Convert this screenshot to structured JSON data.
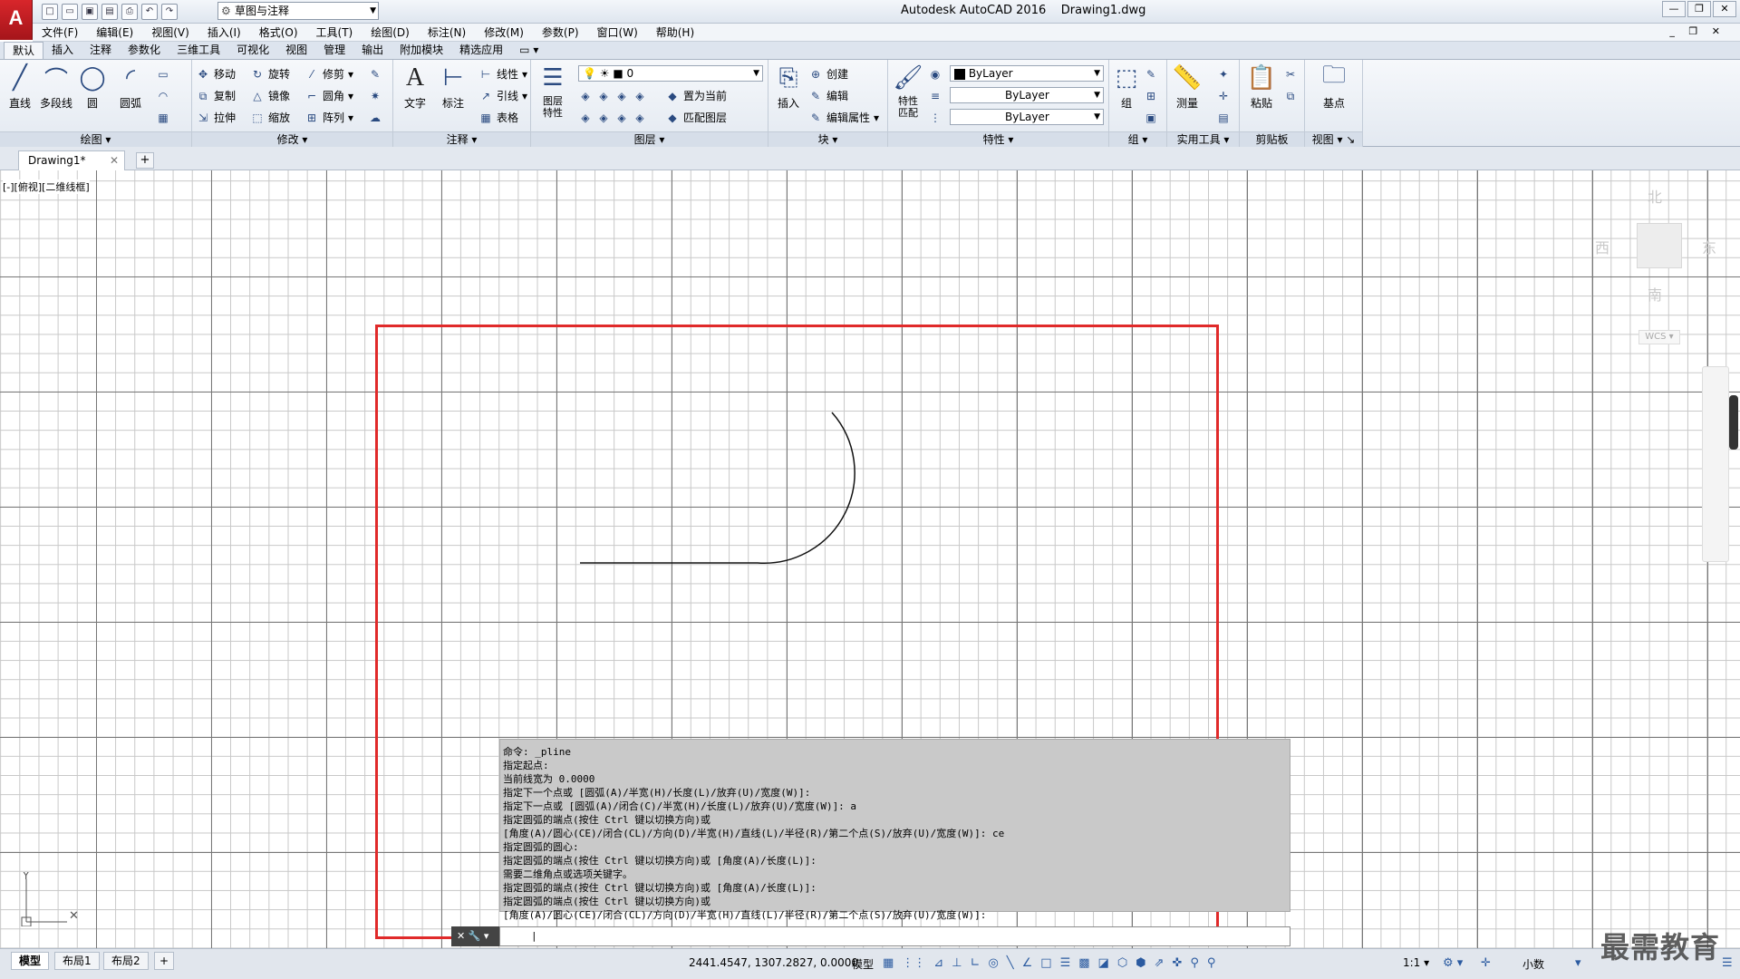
{
  "window": {
    "app_title": "Autodesk AutoCAD 2016",
    "file_title": "Drawing1.dwg",
    "app_letter": "A"
  },
  "qat": {
    "workspace": "草图与注释"
  },
  "menu": [
    "文件(F)",
    "编辑(E)",
    "视图(V)",
    "插入(I)",
    "格式(O)",
    "工具(T)",
    "绘图(D)",
    "标注(N)",
    "修改(M)",
    "参数(P)",
    "窗口(W)",
    "帮助(H)"
  ],
  "ribbon_tabs": [
    "默认",
    "插入",
    "注释",
    "参数化",
    "三维工具",
    "可视化",
    "视图",
    "管理",
    "输出",
    "附加模块",
    "精选应用"
  ],
  "panels": {
    "draw": {
      "title": "绘图",
      "line": "直线",
      "pline": "多段线",
      "circle": "圆",
      "arc": "圆弧"
    },
    "modify": {
      "title": "修改",
      "move": "移动",
      "rotate": "旋转",
      "trim": "修剪",
      "copy": "复制",
      "mirror": "镜像",
      "fillet": "圆角",
      "stretch": "拉伸",
      "scale": "缩放",
      "array": "阵列"
    },
    "annotation": {
      "title": "注释",
      "text": "文字",
      "dim": "标注",
      "linear": "线性",
      "leader": "引线",
      "table": "表格"
    },
    "layers": {
      "title": "图层",
      "props": "图层\n特性",
      "current_layer": "0",
      "set_current": "置为当前",
      "match_layer": "匹配图层"
    },
    "block": {
      "title": "块",
      "insert": "插入",
      "create": "创建",
      "edit": "编辑",
      "edit_attr": "编辑属性"
    },
    "properties": {
      "title": "特性",
      "match": "特性\n匹配",
      "color": "ByLayer",
      "linetype": "ByLayer",
      "lineweight": "ByLayer"
    },
    "groups": {
      "title": "组",
      "group": "组"
    },
    "utilities": {
      "title": "实用工具",
      "measure": "测量"
    },
    "clipboard": {
      "title": "剪贴板",
      "paste": "粘贴"
    },
    "view": {
      "title": "视图",
      "base": "基点"
    }
  },
  "doc_tab": {
    "name": "Drawing1*"
  },
  "viewport": {
    "label": "[-][俯视][二维线框]"
  },
  "viewcube": {
    "north": "北",
    "south": "南",
    "east": "东",
    "west": "西",
    "wcs": "WCS"
  },
  "command_history": [
    "命令: _pline",
    "指定起点:",
    "当前线宽为 0.0000",
    "指定下一个点或 [圆弧(A)/半宽(H)/长度(L)/放弃(U)/宽度(W)]:",
    "指定下一点或 [圆弧(A)/闭合(C)/半宽(H)/长度(L)/放弃(U)/宽度(W)]: a",
    "指定圆弧的端点(按住 Ctrl 键以切换方向)或",
    "[角度(A)/圆心(CE)/闭合(CL)/方向(D)/半宽(H)/直线(L)/半径(R)/第二个点(S)/放弃(U)/宽度(W)]: ce",
    "指定圆弧的圆心:",
    "指定圆弧的端点(按住 Ctrl 键以切换方向)或 [角度(A)/长度(L)]:",
    "需要二维角点或选项关键字。",
    "指定圆弧的端点(按住 Ctrl 键以切换方向)或 [角度(A)/长度(L)]:",
    "指定圆弧的端点(按住 Ctrl 键以切换方向)或",
    "[角度(A)/圆心(CE)/闭合(CL)/方向(D)/半宽(H)/直线(L)/半径(R)/第二个点(S)/放弃(U)/宽度(W)]:"
  ],
  "status": {
    "model_tab": "模型",
    "layout1": "布局1",
    "layout2": "布局2",
    "coords": "2441.4547, 1307.2827, 0.0000",
    "model_btn": "模型",
    "scale": "1:1",
    "units": "小数"
  },
  "watermark": "最需教育",
  "colors": {
    "accent_red": "#e02a2a",
    "app_red": "#c41e24"
  }
}
